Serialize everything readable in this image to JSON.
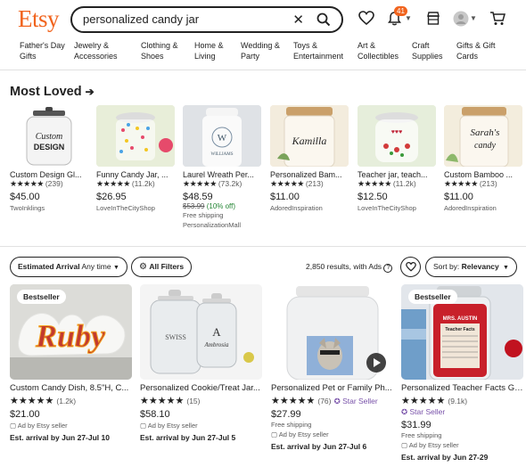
{
  "header": {
    "logo": "Etsy",
    "search_value": "personalized candy jar",
    "notification_count": "41"
  },
  "categories": [
    "Father's Day\nGifts",
    "Jewelry &\nAccessories",
    "Clothing &\nShoes",
    "Home &\nLiving",
    "Wedding &\nParty",
    "Toys &\nEntertainment",
    "Art &\nCollectibles",
    "Craft\nSupplies",
    "Gifts & Gift\nCards"
  ],
  "most_loved": {
    "title": "Most Loved",
    "items": [
      {
        "title": "Custom Design Gl...",
        "rating": "(239)",
        "price": "$45.00",
        "shop": "TwoInklings"
      },
      {
        "title": "Funny Candy Jar, ...",
        "rating": "(11.2k)",
        "price": "$26.95",
        "shop": "LoveInTheCityShop"
      },
      {
        "title": "Laurel Wreath Per...",
        "rating": "(73.2k)",
        "price": "$48.59",
        "old_price": "$53.99",
        "discount": "(10% off)",
        "shipping": "Free shipping",
        "shop": "PersonalizationMall"
      },
      {
        "title": "Personalized Bam...",
        "rating": "(213)",
        "price": "$11.00",
        "shop": "AdoredInspiration"
      },
      {
        "title": "Teacher jar, teach...",
        "rating": "(11.2k)",
        "price": "$12.50",
        "shop": "LoveInTheCityShop"
      },
      {
        "title": "Custom Bamboo ...",
        "rating": "(213)",
        "price": "$11.00",
        "shop": "AdoredInspiration"
      }
    ]
  },
  "filters": {
    "arrival_label": "Estimated Arrival",
    "arrival_value": "Any time",
    "all_filters": "All Filters",
    "results": "2,850 results, with Ads",
    "sort_label": "Sort by:",
    "sort_value": "Relevancy"
  },
  "products": [
    {
      "badge": "Bestseller",
      "title": "Custom Candy Dish, 8.5\"H, C...",
      "rating": "(1.2k)",
      "price": "$21.00",
      "ad": "Ad by Etsy seller",
      "arrival": "Est. arrival by Jun 27-Jul 10"
    },
    {
      "title": "Personalized Cookie/Treat Jar...",
      "rating": "(15)",
      "price": "$58.10",
      "ad": "Ad by Etsy seller",
      "arrival": "Est. arrival by Jun 27-Jul 5"
    },
    {
      "title": "Personalized Pet or Family Ph...",
      "rating": "(76)",
      "star_seller": "Star Seller",
      "price": "$27.99",
      "shipping": "Free shipping",
      "ad": "Ad by Etsy seller",
      "arrival": "Est. arrival by Jun 27-Jul 6"
    },
    {
      "badge": "Bestseller",
      "title": "Personalized Teacher Facts Gl...",
      "rating": "(9.1k)",
      "star_seller": "Star Seller",
      "price": "$31.99",
      "shipping": "Free shipping",
      "ad": "Ad by Etsy seller",
      "arrival": "Est. arrival by Jun 27-29"
    }
  ],
  "image_text": {
    "custom_design": "Custom\nDESIGN",
    "williams": "WILLIAMS",
    "kamilla": "Kamilla",
    "sarahs_candy": "Sarah's\ncandy",
    "ruby": "Ruby",
    "swiss": "SWISS",
    "ambrosia": "Ambrosia",
    "mrs_austin": "MRS. AUSTIN",
    "teacher_facts": "Teacher Facts"
  },
  "colors": {
    "brand": "#f1641e",
    "star_seller": "#7851a9",
    "discount": "#258635"
  }
}
